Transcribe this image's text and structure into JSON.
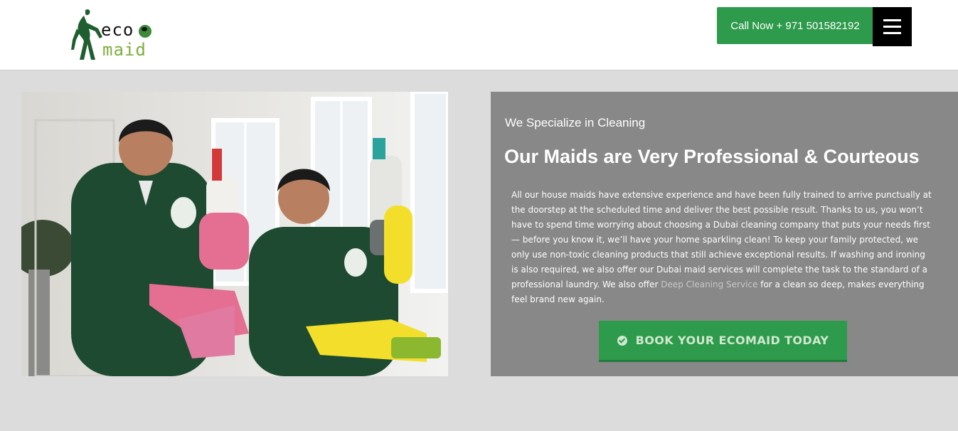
{
  "header": {
    "logo": {
      "line1": "eco",
      "line2": "maid"
    },
    "call_label": "Call Now + 971 501582192",
    "menu_icon": "hamburger-icon"
  },
  "hero_image": {
    "subject": "maids-holding-cleaning-supplies-photo"
  },
  "panel": {
    "kicker": "We Specialize in Cleaning",
    "headline": "Our Maids are Very Professional & Courteous",
    "paragraph_before_link": "All our house maids have extensive experience and have been fully trained to arrive punctually at the doorstep at the scheduled time and deliver the best possible result. Thanks to us, you won’t have to spend time worrying about choosing a Dubai cleaning company that puts your needs first — before you know it, we’ll have your home sparkling clean! To keep your family protected, we only use non-toxic cleaning products that still achieve exceptional results. If washing and ironing is also required, we also offer our Dubai maid services will complete the task to the standard of a professional laundry. We also offer ",
    "link_text": "Deep Cleaning Service",
    "paragraph_after_link": " for a clean so deep, makes everything feel brand new again.",
    "cta_label": "BOOK YOUR ECOMAID TODAY",
    "cta_icon": "check-circle-icon"
  },
  "colors": {
    "brand_green": "#2e9a4b",
    "logo_green": "#7bb03b",
    "panel_gray": "#888888",
    "page_bg": "#dcdcdc"
  }
}
